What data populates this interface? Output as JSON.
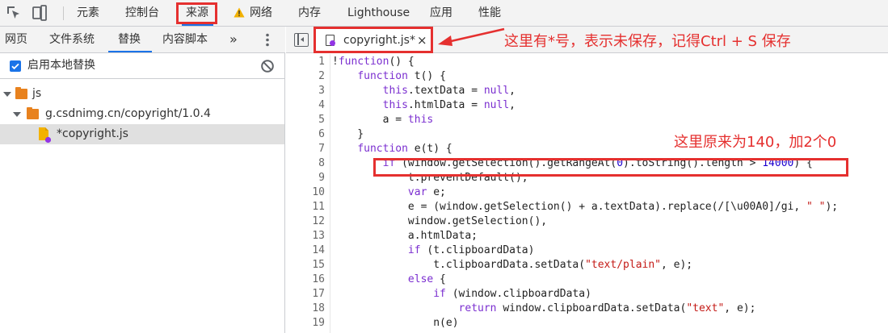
{
  "toolbar": {
    "tabs": [
      "元素",
      "控制台",
      "来源",
      "网络",
      "内存",
      "Lighthouse",
      "应用",
      "性能"
    ],
    "active_tab": "来源"
  },
  "sources": {
    "subtabs": [
      "网页",
      "文件系统",
      "替换",
      "内容脚本"
    ],
    "more": "»",
    "active_subtab": "替换",
    "enable_local_overrides": "启用本地替换",
    "tree": [
      {
        "label": "js"
      },
      {
        "label": "g.csdnimg.cn/copyright/1.0.4"
      },
      {
        "label": "*copyright.js"
      }
    ]
  },
  "editor": {
    "file_tab": "copyright.js*",
    "close": "×",
    "lines": [
      "!function() {",
      "    function t() {",
      "        this.textData = null,",
      "        this.htmlData = null,",
      "        a = this",
      "    }",
      "    function e(t) {",
      "        if (window.getSelection().getRangeAt(0).toString().length > 14000) {",
      "            t.preventDefault();",
      "            var e;",
      "            e = (window.getSelection() + a.textData).replace(/[\\u00A0]/gi, \" \");",
      "            window.getSelection(),",
      "            a.htmlData;",
      "            if (t.clipboardData)",
      "                t.clipboardData.setData(\"text/plain\", e);",
      "            else {",
      "                if (window.clipboardData)",
      "                    return window.clipboardData.setData(\"text\", e);",
      "                n(e)"
    ]
  },
  "annotations": {
    "unsaved_note": "这里有*号，表示未保存，记得Ctrl + S 保存",
    "value_note": "这里原来为140，加2个0"
  },
  "colors": {
    "annotation_red": "#e5302f",
    "accent_blue": "#1a73e8"
  }
}
